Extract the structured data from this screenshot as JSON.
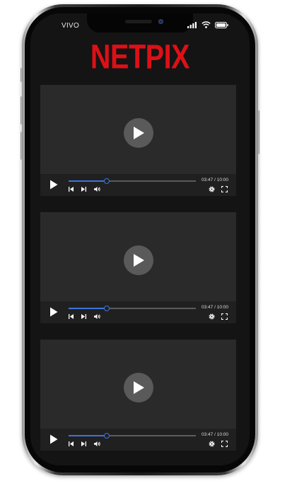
{
  "status_bar": {
    "carrier": "VIVO",
    "icons": [
      "signal-icon",
      "wifi-icon",
      "battery-icon"
    ]
  },
  "app": {
    "logo": "NETPIX",
    "brand_color": "#dd1016"
  },
  "players": [
    {
      "current_time": "03:47",
      "separator": "/",
      "duration": "10:00",
      "progress": 0.3
    },
    {
      "current_time": "03:47",
      "separator": "/",
      "duration": "10:00",
      "progress": 0.3
    },
    {
      "current_time": "03:47",
      "separator": "/",
      "duration": "10:00",
      "progress": 0.3
    }
  ],
  "controls": {
    "icons": [
      "play-icon",
      "skip-back-icon",
      "skip-forward-icon",
      "volume-icon",
      "settings-icon",
      "fullscreen-icon"
    ],
    "accent": "#3f73dc"
  }
}
